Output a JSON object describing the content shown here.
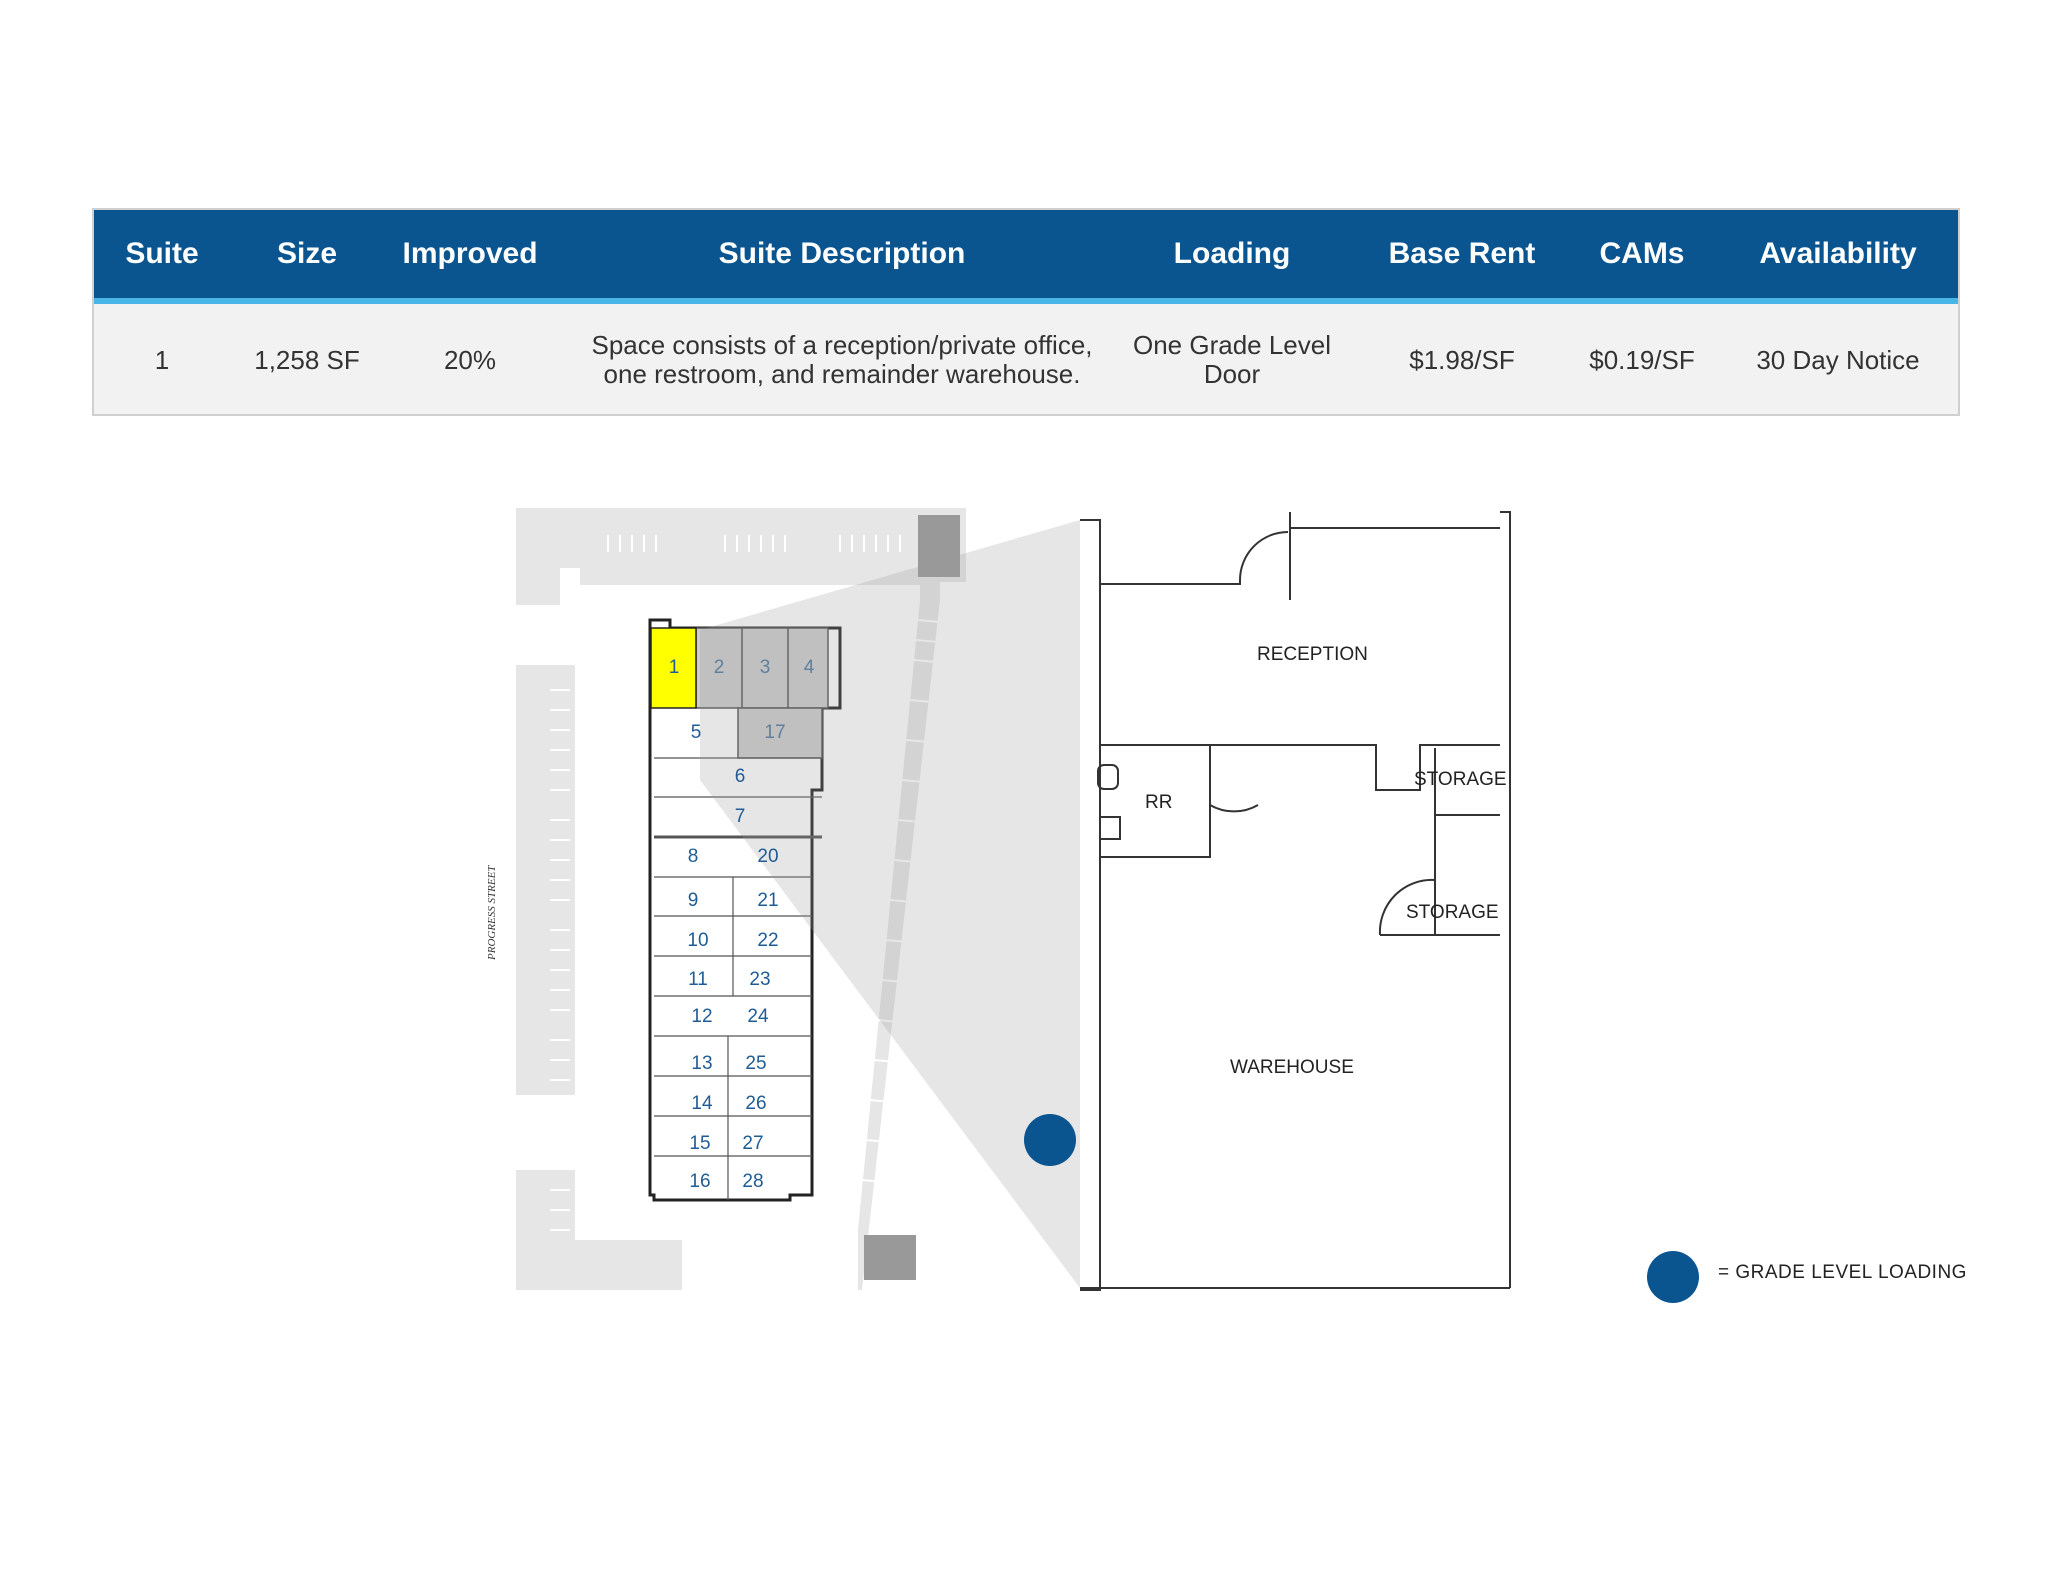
{
  "table": {
    "headers": [
      "Suite",
      "Size",
      "Improved",
      "Suite Description",
      "Loading",
      "Base Rent",
      "CAMs",
      "Availability"
    ],
    "row": {
      "suite": "1",
      "size": "1,258 SF",
      "improved": "20%",
      "description_line1": "Space consists of a reception/private office,",
      "description_line2": "one restroom, and remainder warehouse.",
      "loading_line1": "One Grade Level",
      "loading_line2": "Door",
      "base_rent": "$1.98/SF",
      "cams": "$0.19/SF",
      "availability": "30 Day Notice"
    }
  },
  "site_plan": {
    "street_label": "PROGRESS STREET",
    "highlighted_suite": "1",
    "suites": [
      "1",
      "2",
      "3",
      "4",
      "5",
      "17",
      "6",
      "7",
      "8",
      "20",
      "9",
      "21",
      "10",
      "22",
      "11",
      "23",
      "12",
      "24",
      "13",
      "25",
      "14",
      "26",
      "15",
      "27",
      "16",
      "28"
    ]
  },
  "floor_plan": {
    "rooms": [
      "RECEPTION",
      "RR",
      "STORAGE",
      "STORAGE",
      "WAREHOUSE"
    ]
  },
  "legend": {
    "label": "= GRADE LEVEL LOADING"
  },
  "colors": {
    "header_blue": "#0a5590",
    "accent_line": "#49b4e6",
    "highlight_yellow": "#ffff00",
    "suite_number_blue": "#1f5c96"
  }
}
